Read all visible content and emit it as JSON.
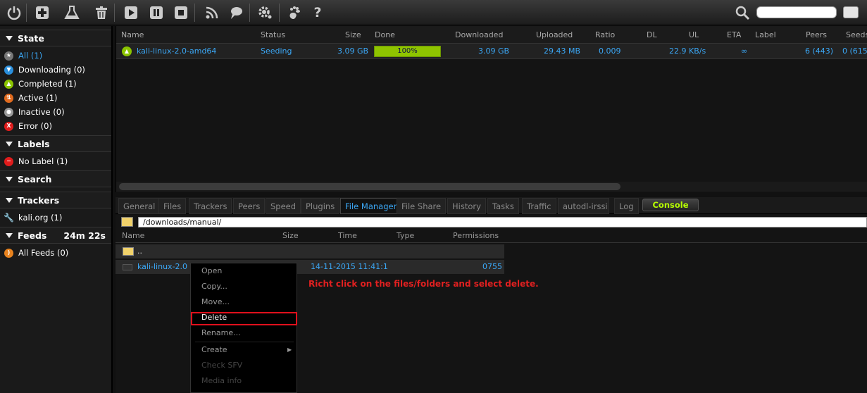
{
  "toolbar": {
    "buttons": [
      "power-icon",
      "add-icon",
      "flask-icon",
      "trash-icon",
      "play-icon",
      "pause-icon",
      "stop-icon",
      "rss-icon",
      "speech-icon",
      "gear-icon",
      "gnome-icon",
      "help-icon"
    ],
    "search_placeholder": ""
  },
  "sidebar": {
    "state_header": "State",
    "state_items": [
      {
        "label": "All (1)",
        "color": "#777777"
      },
      {
        "label": "Downloading (0)",
        "color": "#2a8fdc"
      },
      {
        "label": "Completed (1)",
        "color": "#8bc400"
      },
      {
        "label": "Active (1)",
        "color": "#e06b1f"
      },
      {
        "label": "Inactive (0)",
        "color": "#999999"
      },
      {
        "label": "Error (0)",
        "color": "#e01c1c"
      }
    ],
    "labels_header": "Labels",
    "labels_items": [
      {
        "label": "No Label (1)",
        "color": "#e01c1c"
      }
    ],
    "search_header": "Search",
    "trackers_header": "Trackers",
    "trackers_items": [
      {
        "label": "kali.org (1)"
      }
    ],
    "feeds_header": "Feeds",
    "feeds_time": "24m 22s",
    "feeds_items": [
      {
        "label": "All Feeds (0)",
        "color": "#e8831f"
      }
    ]
  },
  "list": {
    "columns": [
      "Name",
      "Status",
      "Size",
      "Done",
      "Downloaded",
      "Uploaded",
      "Ratio",
      "DL",
      "UL",
      "ETA",
      "Label",
      "Peers",
      "Seeds"
    ],
    "row": {
      "name": "kali-linux-2.0-amd64",
      "status": "Seeding",
      "size": "3.09 GB",
      "done": "100%",
      "done_fraction": 1.0,
      "downloaded": "3.09 GB",
      "uploaded": "29.43 MB",
      "ratio": "0.009",
      "dl": "",
      "ul": "22.9 KB/s",
      "eta": "∞",
      "label": "",
      "peers": "6 (443)",
      "seeds": "0 (615"
    }
  },
  "tabs": {
    "items": [
      "General",
      "Files",
      "Trackers",
      "Peers",
      "Speed",
      "Plugins",
      "File Manager",
      "File Share",
      "History",
      "Tasks",
      "Traffic",
      "autodl-irssi",
      "Log"
    ],
    "selected": "File Manager",
    "console_label": "Console"
  },
  "file_manager": {
    "path": "/downloads/manual/",
    "columns": [
      "Name",
      "Size",
      "Time",
      "Type",
      "Permissions"
    ],
    "up_row": "..",
    "file_row": {
      "name": "kali-linux-2.0",
      "time": "14-11-2015 11:41:1",
      "permissions": "0755"
    }
  },
  "context_menu": {
    "items": [
      {
        "label": "Open",
        "state": "normal"
      },
      {
        "label": "Copy...",
        "state": "normal"
      },
      {
        "label": "Move...",
        "state": "normal"
      },
      {
        "label": "Delete",
        "state": "bright"
      },
      {
        "label": "Rename...",
        "state": "normal"
      },
      {
        "label": "Create",
        "state": "normal"
      },
      {
        "label": "Check SFV",
        "state": "disabled"
      },
      {
        "label": "Media info",
        "state": "disabled"
      }
    ]
  },
  "annotation": "Richt click on the files/folders and select delete."
}
